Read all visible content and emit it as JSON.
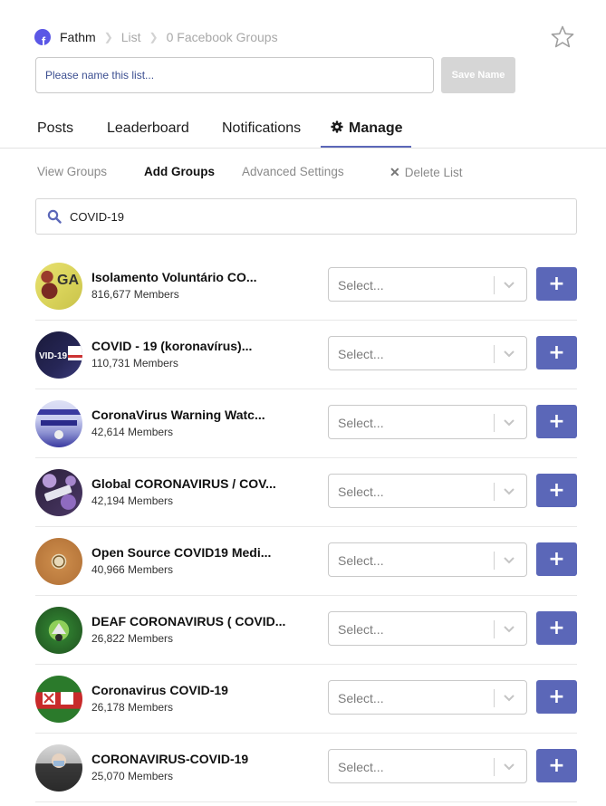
{
  "breadcrumb": {
    "brand": "Fathm",
    "list": "List",
    "groups": "0 Facebook Groups"
  },
  "list_name": {
    "placeholder": "Please name this list...",
    "save_label": "Save Name"
  },
  "tabs": [
    {
      "label": "Posts"
    },
    {
      "label": "Leaderboard"
    },
    {
      "label": "Notifications"
    },
    {
      "label": "Manage",
      "active": true
    }
  ],
  "subtabs": {
    "view_groups": "View Groups",
    "add_groups": "Add Groups",
    "advanced_settings": "Advanced Settings",
    "delete_list": "Delete List"
  },
  "search": {
    "value": "COVID-19"
  },
  "select_placeholder": "Select...",
  "add_label": "+",
  "colors": {
    "accent": "#5b67b8",
    "brand": "#5b57e6"
  },
  "groups": [
    {
      "name": "Isolamento Voluntário CO...",
      "members": "816,677 Members"
    },
    {
      "name": "COVID - 19 (koronavírus)...",
      "members": "110,731 Members"
    },
    {
      "name": "CoronaVirus Warning Watc...",
      "members": "42,614 Members"
    },
    {
      "name": "Global CORONAVIRUS / COV...",
      "members": "42,194 Members"
    },
    {
      "name": "Open Source COVID19 Medi...",
      "members": "40,966 Members"
    },
    {
      "name": "DEAF CORONAVIRUS ( COVID...",
      "members": "26,822 Members"
    },
    {
      "name": "Coronavirus COVID-19",
      "members": "26,178 Members"
    },
    {
      "name": "CORONAVIRUS-COVID-19",
      "members": "25,070 Members"
    }
  ]
}
